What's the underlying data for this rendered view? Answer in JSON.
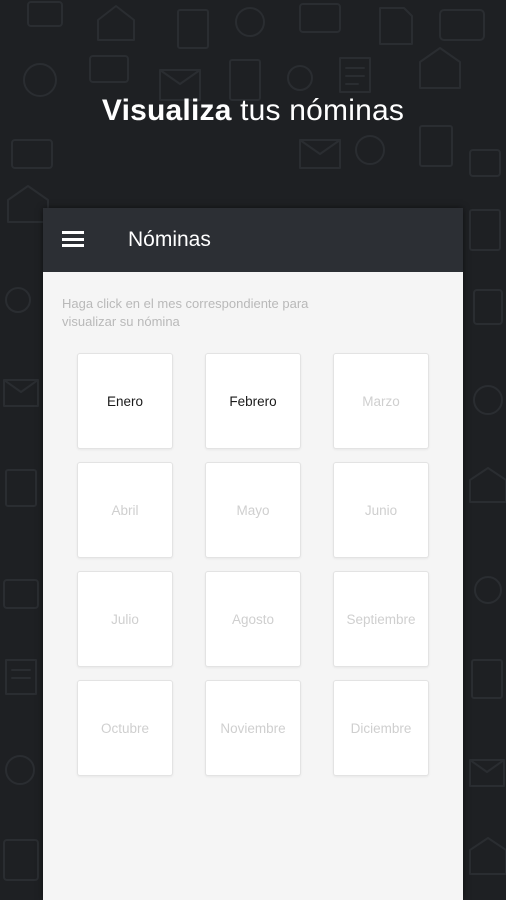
{
  "headline": {
    "bold": "Visualiza",
    "rest": " tus nóminas"
  },
  "appbar": {
    "title": "Nóminas",
    "menu_icon": "hamburger-menu-icon"
  },
  "instructions": "Haga click en el mes correspondiente para visualizar su nómina",
  "colors": {
    "background": "#1e2023",
    "appbar": "#2c2f34",
    "content": "#f5f5f5",
    "active_text": "#1a1a1a",
    "inactive_text": "#cfcfcf"
  },
  "months": [
    {
      "label": "Enero",
      "available": true
    },
    {
      "label": "Febrero",
      "available": true
    },
    {
      "label": "Marzo",
      "available": false
    },
    {
      "label": "Abril",
      "available": false
    },
    {
      "label": "Mayo",
      "available": false
    },
    {
      "label": "Junio",
      "available": false
    },
    {
      "label": "Julio",
      "available": false
    },
    {
      "label": "Agosto",
      "available": false
    },
    {
      "label": "Septiembre",
      "available": false
    },
    {
      "label": "Octubre",
      "available": false
    },
    {
      "label": "Noviembre",
      "available": false
    },
    {
      "label": "Diciembre",
      "available": false
    }
  ]
}
